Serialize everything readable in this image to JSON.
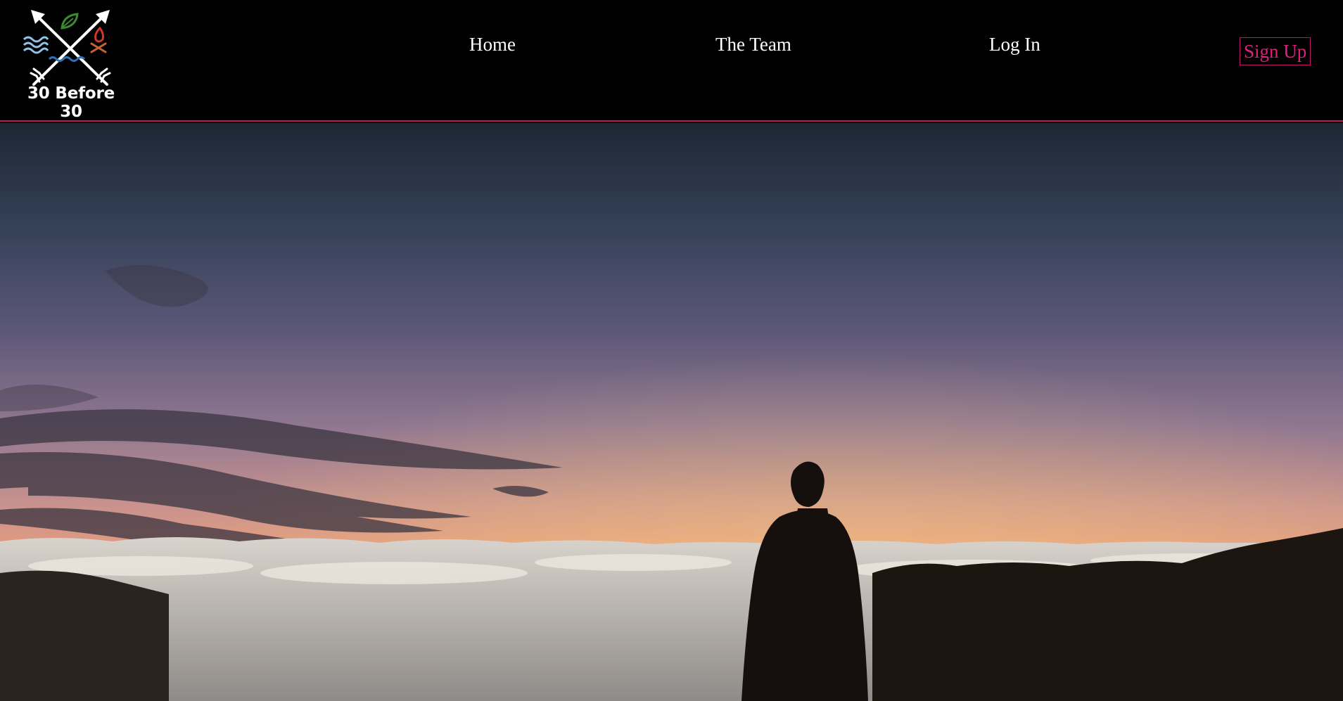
{
  "logo": {
    "text": "30 Before 30",
    "icon": "crossed-arrows-elements-icon",
    "colors": {
      "water": "#8fc4e8",
      "leaf": "#3a8a2e",
      "fire": "#d2372b",
      "wood": "#c4662b",
      "waves": "#2f6fb5"
    }
  },
  "nav": {
    "items": [
      {
        "label": "Home"
      },
      {
        "label": "The Team"
      },
      {
        "label": "Log In"
      }
    ],
    "signup_label": "Sign Up"
  },
  "colors": {
    "accent": "#c0136f",
    "accent_text": "#e0207f",
    "nav_text": "#ffffff",
    "background": "#000000"
  },
  "hero": {
    "image": "sunset-above-clouds-with-silhouetted-hiker"
  }
}
